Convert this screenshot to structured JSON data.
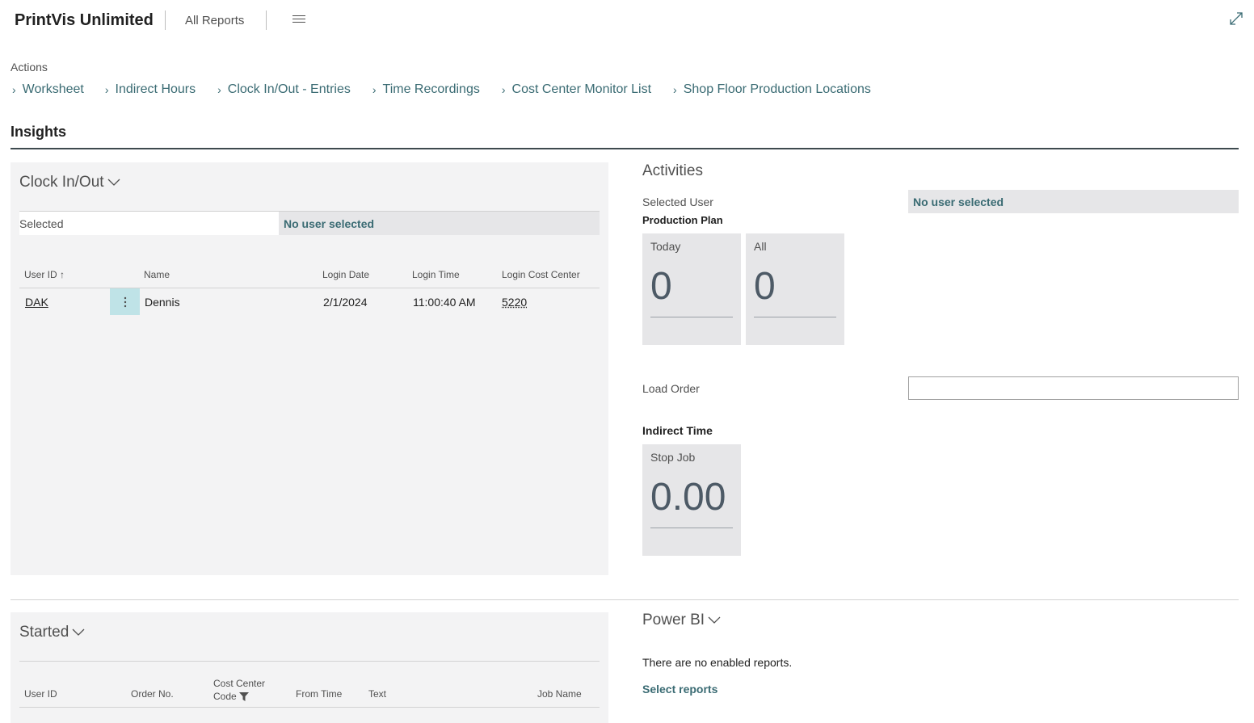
{
  "header": {
    "app_title": "PrintVis Unlimited",
    "all_reports": "All Reports"
  },
  "actions": {
    "label": "Actions",
    "items": [
      {
        "label": "Worksheet"
      },
      {
        "label": "Indirect Hours"
      },
      {
        "label": "Clock In/Out - Entries"
      },
      {
        "label": "Time Recordings"
      },
      {
        "label": "Cost Center Monitor List"
      },
      {
        "label": "Shop Floor Production Locations"
      }
    ]
  },
  "insights": {
    "title": "Insights"
  },
  "clock_in_out": {
    "title": "Clock In/Out",
    "selected_label": "Selected",
    "selected_value": "No user selected",
    "columns": {
      "user_id": "User ID",
      "name": "Name",
      "login_date": "Login Date",
      "login_time": "Login Time",
      "login_cost_center": "Login Cost Center"
    },
    "rows": [
      {
        "user_id": "DAK",
        "name": "Dennis",
        "login_date": "2/1/2024",
        "login_time": "11:00:40 AM",
        "login_cost_center": "5220"
      }
    ]
  },
  "activities": {
    "title": "Activities",
    "selected_user_label": "Selected User",
    "selected_user_value": "No user selected",
    "production_plan_label": "Production Plan",
    "cues": [
      {
        "label": "Today",
        "value": "0"
      },
      {
        "label": "All",
        "value": "0"
      }
    ],
    "load_order_label": "Load Order",
    "load_order_value": "",
    "indirect_time_label": "Indirect Time",
    "indirect_cue": {
      "label": "Stop Job",
      "value": "0.00"
    }
  },
  "started": {
    "title": "Started",
    "columns": {
      "user_id": "User ID",
      "order_no": "Order No.",
      "cost_center_code_1": "Cost Center",
      "cost_center_code_2": "Code",
      "from_time": "From Time",
      "text": "Text",
      "job_name": "Job Name"
    }
  },
  "power_bi": {
    "title": "Power BI",
    "message": "There are no enabled reports.",
    "select_reports": "Select reports"
  },
  "colors": {
    "accent": "#3a6b73",
    "panel_bg": "#f3f3f4",
    "cue_bg": "#e6e6e8",
    "row_action_bg": "#bfe3e7"
  },
  "icons": {
    "menu": "hamburger-icon",
    "expand": "expand-icon",
    "action_chevron": "chevron-right-icon",
    "part_toggle": "chevron-down-icon",
    "sort": "sort-ascending-icon",
    "filter": "filter-icon",
    "row_actions": "more-vertical-icon"
  }
}
